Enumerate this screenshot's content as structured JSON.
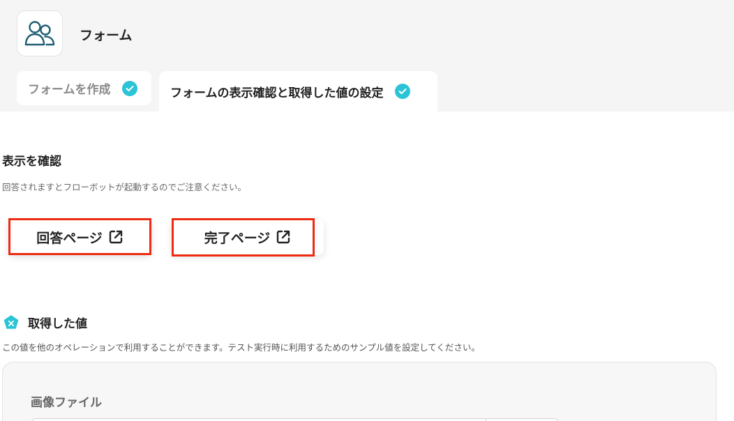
{
  "app": {
    "title": "フォーム",
    "icon": "users-icon"
  },
  "tabs": [
    {
      "label": "フォームを作成",
      "status": "check-icon",
      "active": false
    },
    {
      "label": "フォームの表示確認と取得した値の設定",
      "status": "check-icon",
      "active": true
    }
  ],
  "display_check": {
    "title": "表示を確認",
    "description": "回答されますとフローボットが起動するのでご注意ください。",
    "buttons": [
      {
        "label": "回答ページ",
        "icon": "external-link-icon"
      },
      {
        "label": "完了ページ",
        "icon": "external-link-icon"
      }
    ]
  },
  "values": {
    "title": "取得した値",
    "icon": "variable-x-icon",
    "description": "この値を他のオペレーションで利用することができます。テスト実行時に利用するためのサンプル値を設定してください。",
    "fields": [
      {
        "label": "画像ファイル",
        "value": ""
      }
    ]
  },
  "colors": {
    "accent": "#2bc4d6",
    "highlight": "#ee2a12",
    "icon_dark": "#1d5d73"
  }
}
